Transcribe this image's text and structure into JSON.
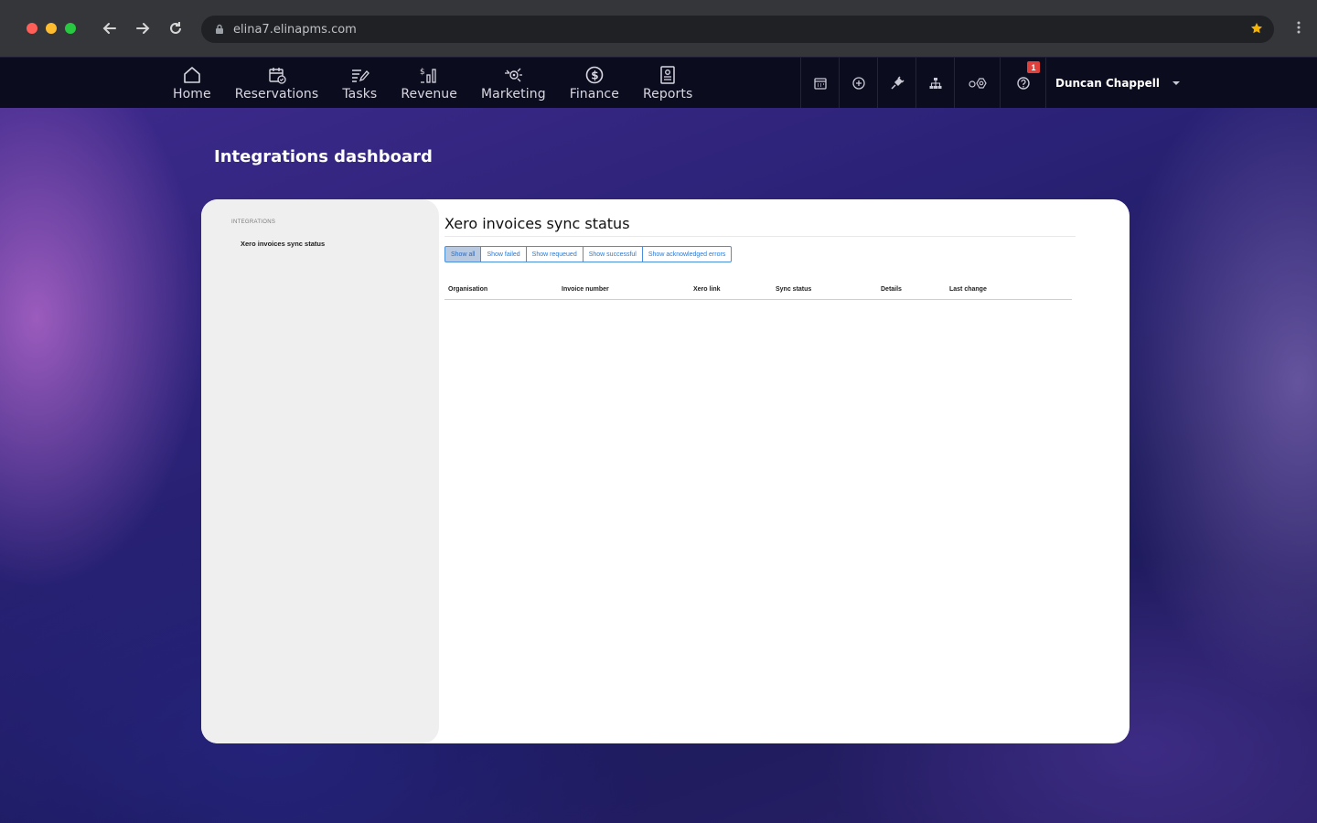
{
  "browser": {
    "url": "elina7.elinapms.com",
    "traffic_colors": [
      "#ff5f57",
      "#febc2e",
      "#28c840"
    ]
  },
  "nav": {
    "items": [
      {
        "label": "Home",
        "icon": "home-icon"
      },
      {
        "label": "Reservations",
        "icon": "calendar-check-icon"
      },
      {
        "label": "Tasks",
        "icon": "task-list-icon"
      },
      {
        "label": "Revenue",
        "icon": "revenue-chart-icon"
      },
      {
        "label": "Marketing",
        "icon": "marketing-icon"
      },
      {
        "label": "Finance",
        "icon": "dollar-circle-icon"
      },
      {
        "label": "Reports",
        "icon": "report-icon"
      }
    ],
    "tools": [
      "calendar-icon",
      "plus-circle-icon",
      "plug-icon",
      "sitemap-icon",
      "settings-icon",
      "help-icon"
    ],
    "notification_count": "1",
    "user_name": "Duncan Chappell"
  },
  "page": {
    "title": "Integrations dashboard"
  },
  "sidebar": {
    "section": "INTEGRATIONS",
    "link": "Xero invoices sync status"
  },
  "content": {
    "heading": "Xero invoices sync status",
    "filters": [
      "Show all",
      "Show failed",
      "Show requeued",
      "Show successful",
      "Show acknowledged errors"
    ],
    "active_filter": "Show all",
    "columns": [
      "Organisation",
      "Invoice number",
      "Xero link",
      "Sync status",
      "Details",
      "Last change"
    ],
    "rows": []
  },
  "colors": {
    "accent": "#2a7ad4",
    "nav_bg": "#0c0c1f",
    "badge": "#e0403c",
    "star": "#f5b400"
  }
}
